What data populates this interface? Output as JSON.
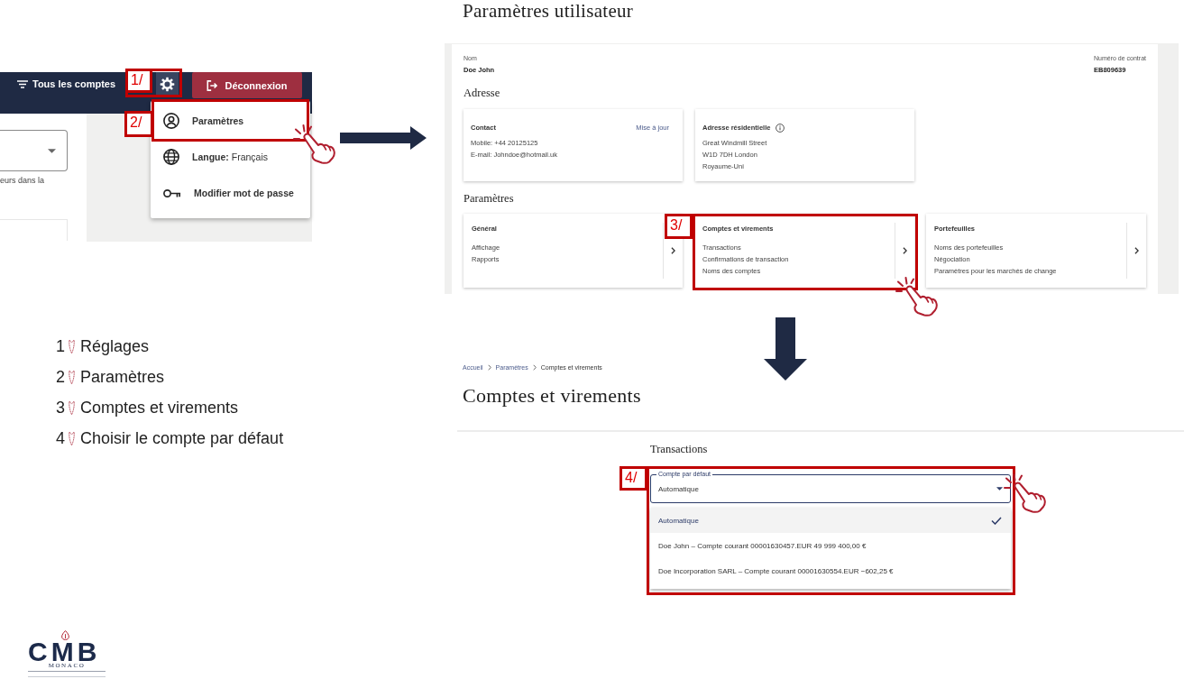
{
  "settings_menu_capture": {
    "top_bar": {
      "filter": "Tous les comptes",
      "settings_button": {
        "callout": "1/"
      },
      "logout_button": "Déconnexion"
    },
    "account_field": {
      "helper_text": "eurs dans la"
    },
    "menu": [
      {
        "label": "Paramètres",
        "callout": "2/"
      },
      {
        "label": "Langue:",
        "value": "Français"
      },
      {
        "label": "Modifier mot de passe"
      }
    ]
  },
  "user_settings_capture": {
    "title": "Paramètres utilisateur",
    "name": {
      "label": "Nom",
      "value": "Doe John"
    },
    "contract": {
      "label": "Numéro de contrat",
      "value": "EB809639"
    },
    "address_heading": "Adresse",
    "address_cards": [
      {
        "kind": "editable",
        "title": "Contact",
        "link": "Mise à jour",
        "lines": [
          "Mobile: +44 20125125",
          "E-mail: Johndoe@hotmail.uk"
        ]
      },
      {
        "kind": "info",
        "title": "Adresse résidentielle",
        "lines": [
          "Great Windmill Street",
          "W1D 7DH London",
          "Royaume-Uni"
        ]
      }
    ],
    "settings_heading": "Paramètres",
    "settings_cards": [
      {
        "title": "Général",
        "items": [
          "Affichage",
          "Rapports"
        ]
      },
      {
        "title": "Comptes et virements",
        "items": [
          "Transactions",
          "Confirmations de transaction",
          "Noms des comptes"
        ],
        "callout": "3/"
      },
      {
        "title": "Portefeuilles",
        "items": [
          "Noms des portefeuilles",
          "Négociation",
          "Paramètres pour les marchés de change"
        ]
      }
    ]
  },
  "accounts_capture": {
    "breadcrumb": [
      "Accueil",
      "Paramètres",
      "Comptes et virements"
    ],
    "title": "Comptes et virements",
    "section": "Transactions",
    "default_account": {
      "label": "Compte par défaut",
      "value": "Automatique",
      "expanded": true,
      "callout": "4/",
      "options": [
        {
          "label": "Automatique",
          "selected": true
        },
        {
          "label": "Doe John – Compte courant 00001630457.EUR 49 999 400,00 €",
          "selected": false
        },
        {
          "label": "Doe Incorporation SARL – Compte courant 00001630554.EUR −602,25 €",
          "selected": false
        }
      ]
    }
  },
  "steps": [
    {
      "number": "1",
      "label": "Réglages"
    },
    {
      "number": "2",
      "label": "Paramètres"
    },
    {
      "number": "3",
      "label": "Comptes et virements"
    },
    {
      "number": "4",
      "label": "Choisir le compte par défaut"
    }
  ],
  "logo": {
    "wordmark": "CMB",
    "subtitle": "MONACO"
  }
}
